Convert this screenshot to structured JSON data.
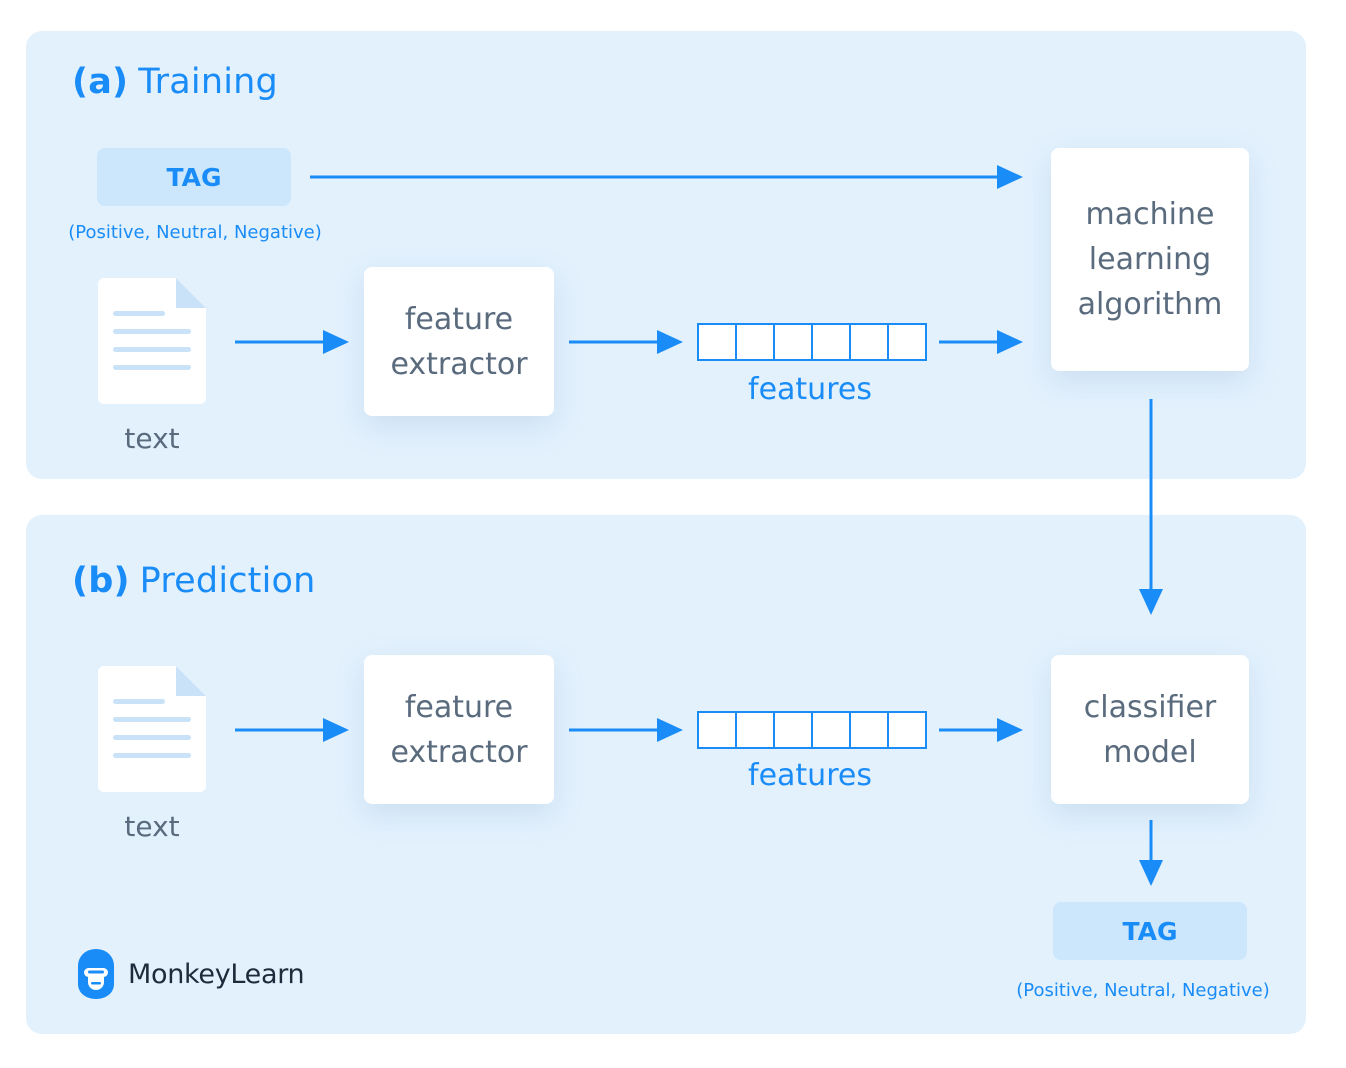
{
  "colors": {
    "accent": "#1a8cf7",
    "panel_bg": "#e3f1fd",
    "tag_bg": "#cce6fb",
    "card_text": "#5a6b7e"
  },
  "training": {
    "letter": "(a)",
    "title": "Training",
    "tag": {
      "label": "TAG",
      "sublabel": "(Positive, Neutral, Negative)"
    },
    "doc_caption": "text",
    "extractor": "feature\nextractor",
    "features_label": "features",
    "feature_cells": 6,
    "algorithm": "machine\nlearning\nalgorithm"
  },
  "prediction": {
    "letter": "(b)",
    "title": "Prediction",
    "doc_caption": "text",
    "extractor": "feature\nextractor",
    "features_label": "features",
    "feature_cells": 6,
    "model": "classifier\nmodel",
    "tag": {
      "label": "TAG",
      "sublabel": "(Positive, Neutral, Negative)"
    }
  },
  "brand": {
    "name": "MonkeyLearn",
    "icon": "monkey-logo-icon"
  }
}
